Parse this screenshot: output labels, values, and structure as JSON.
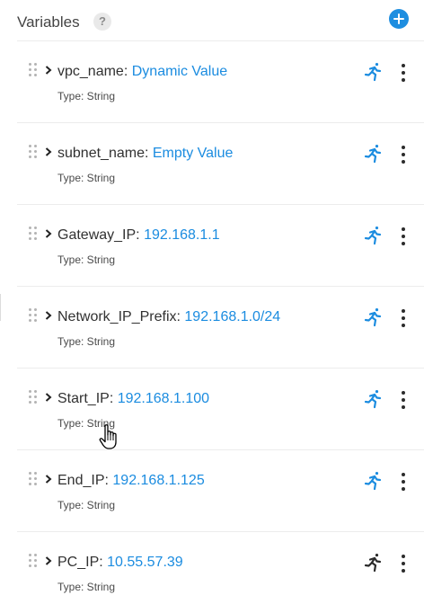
{
  "header": {
    "title": "Variables",
    "help_glyph": "?",
    "help_icon": "question-icon",
    "add_icon": "plus-circle-icon"
  },
  "colors": {
    "accent": "#1b8ce0",
    "run_active": "#1b8ce0",
    "run_inactive": "#2b2b2b"
  },
  "variables": [
    {
      "name": "vpc_name",
      "separator": ":",
      "value": "Dynamic Value",
      "type_label": "Type: String",
      "run_active": true
    },
    {
      "name": "subnet_name",
      "separator": ":",
      "value": "Empty Value",
      "type_label": "Type: String",
      "run_active": true
    },
    {
      "name": "Gateway_IP",
      "separator": ":",
      "value": "192.168.1.1",
      "type_label": "Type: String",
      "run_active": true
    },
    {
      "name": "Network_IP_Prefix",
      "separator": ":",
      "value": "192.168.1.0/24",
      "type_label": "Type: String",
      "run_active": true
    },
    {
      "name": "Start_IP",
      "separator": ":",
      "value": "192.168.1.100",
      "type_label": "Type: String",
      "run_active": true
    },
    {
      "name": "End_IP",
      "separator": ":",
      "value": "192.168.1.125",
      "type_label": "Type: String",
      "run_active": true
    },
    {
      "name": "PC_IP",
      "separator": ":",
      "value": "10.55.57.39",
      "type_label": "Type: String",
      "run_active": false
    }
  ]
}
